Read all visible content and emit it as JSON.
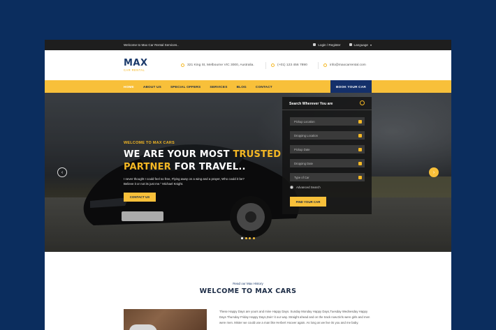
{
  "topbar": {
    "welcome": "Welcome to Max Car Rental Services..",
    "login": "Login / Register",
    "language": "Language"
  },
  "header": {
    "brand": "MAX",
    "tagline": "CAR RENTAL",
    "address": "321 King St, Melbourne VIC 3000, Australia.",
    "phone": "(+01) 123 456 7890",
    "email": "info@maxcarrental.com"
  },
  "nav": {
    "items": [
      "HOME",
      "ABOUT US",
      "SPECIAL OFFERS",
      "SERVICES",
      "BLOG",
      "CONTACT"
    ],
    "book": "BOOK YOUR CAR"
  },
  "hero": {
    "kicker": "WELCOME TO MAX CARS",
    "h1_part1": "WE ARE YOUR MOST ",
    "h1_highlight1": "TRUSTED",
    "h1_highlight2": "PARTNER",
    "h1_part2": " FOR TRAVEL..",
    "quote": "I never thought I could feel so free, Flying away on a wing and a prayer, Who could it be? Believe it or not its just me.\" Michael Knight.",
    "cta": "CONTACT US"
  },
  "search": {
    "title": "Search Wherever You are",
    "fields": [
      "Pickup Location",
      "Dropping Location",
      "Pickup Date",
      "Dropping Date",
      "Type of Car"
    ],
    "advanced": "Advanced Search",
    "button": "FIND YOUR CAR"
  },
  "about": {
    "small": "Read our Max History",
    "title": "WELCOME TO MAX CARS",
    "para": "These Happy Days are yours and mine Happy Days. Sunday Monday Happy Days,Tuesday Wednesday Happy Days Thursday Friday Happy Days,Doin' it our way. Straight ahead and on the track now.Girls were girls and men were men. Mister we could use a man like Herbert Hoover again. As long as we live its you and me baby."
  },
  "colors": {
    "background": "#0b2d5e",
    "accent": "#f8c03a",
    "navy": "#14306a",
    "topbar": "#1e1e1e"
  },
  "icons": [
    "user-icon",
    "globe-icon",
    "location-icon",
    "phone-icon",
    "email-icon",
    "chevron-left-icon",
    "chevron-right-icon",
    "steering-icon",
    "pin-icon",
    "calendar-icon",
    "car-icon"
  ]
}
